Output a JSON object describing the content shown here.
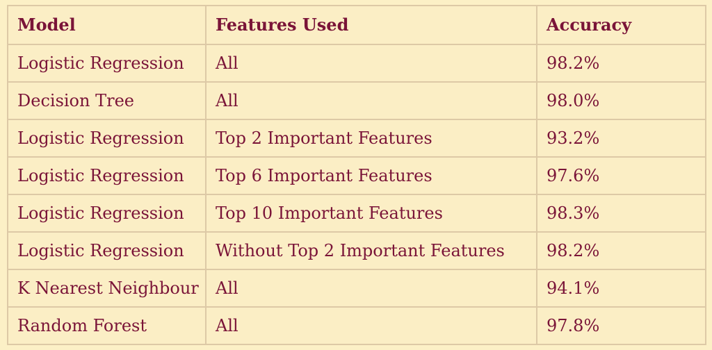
{
  "table": {
    "headers": [
      "Model",
      "Features Used",
      "Accuracy"
    ],
    "rows": [
      [
        "Logistic Regression",
        "All",
        "98.2%"
      ],
      [
        "Decision Tree",
        "All",
        "98.0%"
      ],
      [
        "Logistic Regression",
        "Top 2 Important Features",
        "93.2%"
      ],
      [
        "Logistic Regression",
        "Top 6 Important Features",
        "97.6%"
      ],
      [
        "Logistic Regression",
        "Top 10 Important Features",
        "98.3%"
      ],
      [
        "Logistic Regression",
        "Without Top 2 Important Features",
        "98.2%"
      ],
      [
        "K Nearest Neighbour",
        "All",
        "94.1%"
      ],
      [
        "Random Forest",
        "All",
        "97.8%"
      ]
    ]
  },
  "colors": {
    "background": "#fcf0c6",
    "text": "#7a1438",
    "border": "#ddc9a6"
  }
}
